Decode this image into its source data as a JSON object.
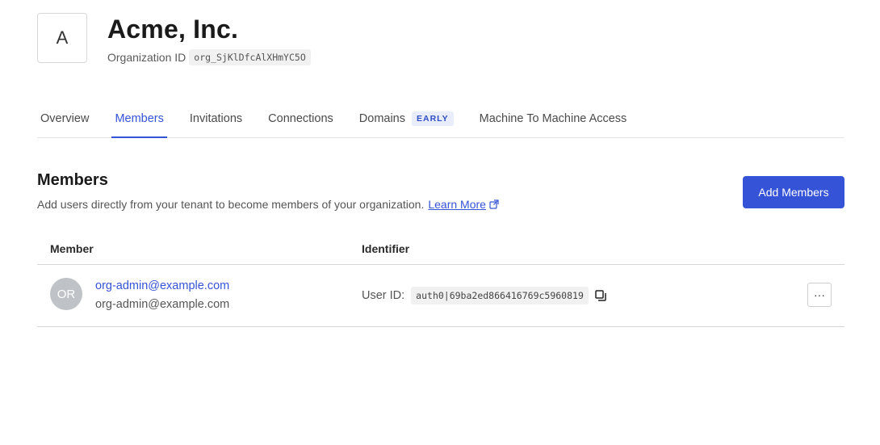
{
  "org": {
    "avatar_letter": "A",
    "name": "Acme, Inc.",
    "id_label": "Organization ID",
    "id_value": "org_SjKlDfcAlXHmYC5O"
  },
  "tabs": [
    {
      "label": "Overview",
      "active": false
    },
    {
      "label": "Members",
      "active": true
    },
    {
      "label": "Invitations",
      "active": false
    },
    {
      "label": "Connections",
      "active": false
    },
    {
      "label": "Domains",
      "badge": "EARLY",
      "active": false
    },
    {
      "label": "Machine To Machine Access",
      "active": false
    }
  ],
  "section": {
    "title": "Members",
    "description": "Add users directly from your tenant to become members of your organization.",
    "learn_more": "Learn More",
    "add_button": "Add Members"
  },
  "table": {
    "columns": [
      "Member",
      "Identifier"
    ],
    "rows": [
      {
        "avatar_initials": "OR",
        "name": "org-admin@example.com",
        "email": "org-admin@example.com",
        "identifier_label": "User ID:",
        "identifier_value": "auth0|69ba2ed866416769c5960819",
        "more": "···"
      }
    ]
  },
  "colors": {
    "accent": "#3553d6",
    "badge_bg": "#e8ecfb",
    "avatar_bg": "#bfc3c7"
  },
  "icons": {
    "learn_more": "external-link-icon",
    "copy": "copy-icon",
    "more": "more-horizontal-icon"
  }
}
